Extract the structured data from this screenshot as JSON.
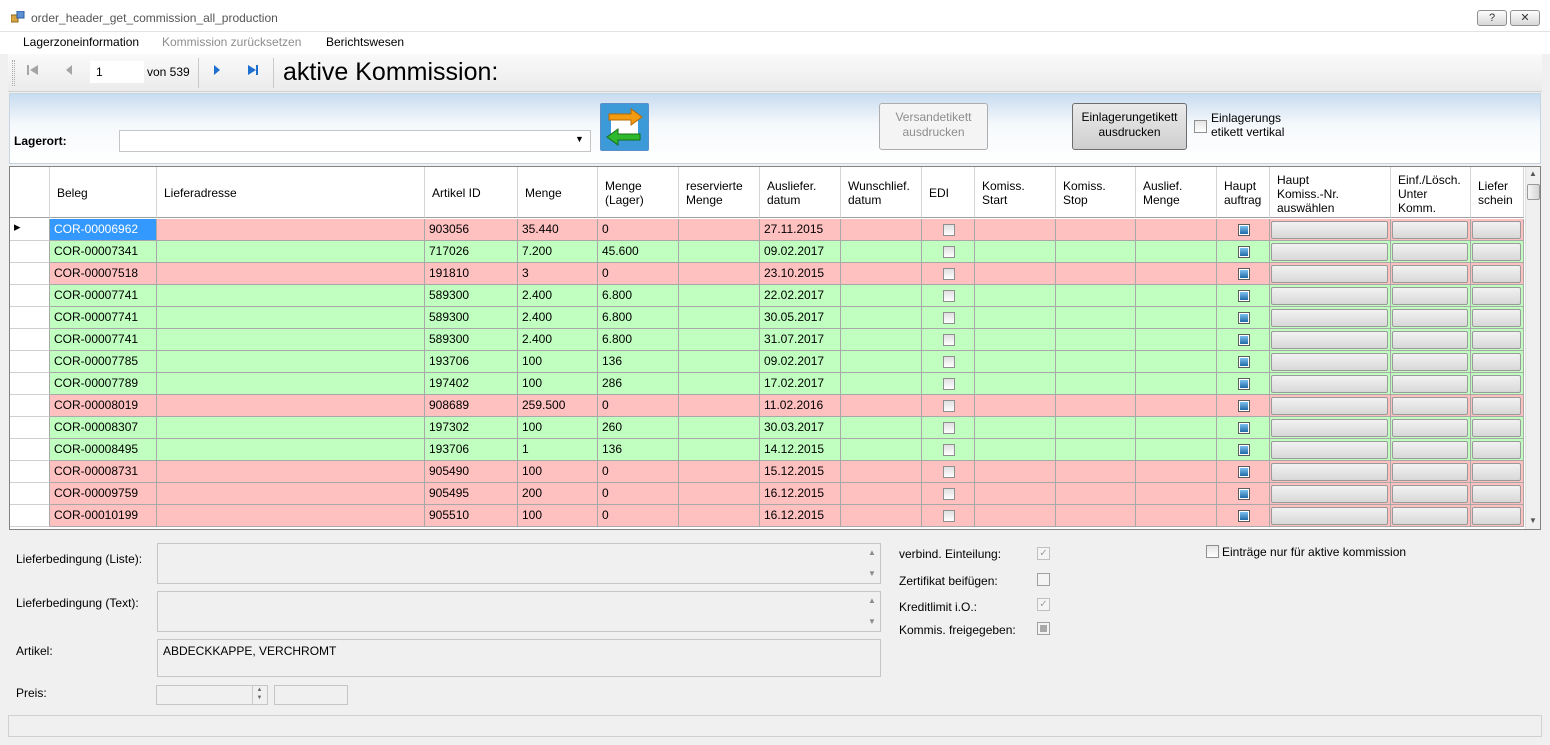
{
  "window": {
    "title": "order_header_get_commission_all_production",
    "help_btn": "?",
    "close_btn": "✕"
  },
  "menu": [
    "Lagerzoneinformation",
    "Kommission zurücksetzen",
    "Berichtswesen"
  ],
  "nav": {
    "first": "⏮",
    "prev": "◀",
    "page": "1",
    "of": "von 539",
    "next": "▶",
    "last": "⏭",
    "active_label": "aktive Kommission:"
  },
  "panel": {
    "lagerort_label": "Lagerort:",
    "lagerort_value": "",
    "versand_btn": [
      "Versandetikett",
      "ausdrucken"
    ],
    "einlager_btn": [
      "Einlagerungetikett",
      "ausdrucken"
    ],
    "vertikal_label": [
      "Einlagerungs",
      "etikett vertikal"
    ],
    "vertikal_checked": false
  },
  "grid": {
    "columns": [
      {
        "key": "beleg",
        "label": [
          "Beleg"
        ]
      },
      {
        "key": "lieferadresse",
        "label": [
          "Lieferadresse"
        ]
      },
      {
        "key": "artikel",
        "label": [
          "Artikel ID"
        ]
      },
      {
        "key": "menge",
        "label": [
          "Menge"
        ]
      },
      {
        "key": "menge_lager",
        "label": [
          "Menge",
          "(Lager)"
        ]
      },
      {
        "key": "reserviert",
        "label": [
          "reservierte",
          "Menge"
        ]
      },
      {
        "key": "auslief",
        "label": [
          "Ausliefer.",
          "datum"
        ]
      },
      {
        "key": "wunsch",
        "label": [
          "Wunschlief.",
          "datum"
        ]
      },
      {
        "key": "edi",
        "label": [
          "EDI"
        ]
      },
      {
        "key": "kstart",
        "label": [
          "Komiss.",
          "Start"
        ]
      },
      {
        "key": "kstop",
        "label": [
          "Komiss.",
          "Stop"
        ]
      },
      {
        "key": "amenge",
        "label": [
          "Auslief.",
          "Menge"
        ]
      },
      {
        "key": "haupt",
        "label": [
          "Haupt",
          "auftrag"
        ]
      },
      {
        "key": "hauptk",
        "label": [
          "Haupt",
          "Komiss.-Nr.",
          "auswählen"
        ]
      },
      {
        "key": "einf",
        "label": [
          "Einf./Lösch.",
          "Unter",
          "Komm."
        ]
      },
      {
        "key": "liefer",
        "label": [
          "Liefer",
          "schein"
        ]
      }
    ],
    "rows": [
      {
        "beleg": "COR-00006962",
        "artikel": "903056",
        "menge": "35.440",
        "menge_lager": "0",
        "auslief": "27.11.2015",
        "status": "red",
        "selected": true,
        "current": true
      },
      {
        "beleg": "COR-00007341",
        "artikel": "717026",
        "menge": "7.200",
        "menge_lager": "45.600",
        "auslief": "09.02.2017",
        "status": "green"
      },
      {
        "beleg": "COR-00007518",
        "artikel": "191810",
        "menge": "3",
        "menge_lager": "0",
        "auslief": "23.10.2015",
        "status": "red"
      },
      {
        "beleg": "COR-00007741",
        "artikel": "589300",
        "menge": "2.400",
        "menge_lager": "6.800",
        "auslief": "22.02.2017",
        "status": "green"
      },
      {
        "beleg": "COR-00007741",
        "artikel": "589300",
        "menge": "2.400",
        "menge_lager": "6.800",
        "auslief": "30.05.2017",
        "status": "green"
      },
      {
        "beleg": "COR-00007741",
        "artikel": "589300",
        "menge": "2.400",
        "menge_lager": "6.800",
        "auslief": "31.07.2017",
        "status": "green"
      },
      {
        "beleg": "COR-00007785",
        "artikel": "193706",
        "menge": "100",
        "menge_lager": "136",
        "auslief": "09.02.2017",
        "status": "green"
      },
      {
        "beleg": "COR-00007789",
        "artikel": "197402",
        "menge": "100",
        "menge_lager": "286",
        "auslief": "17.02.2017",
        "status": "green"
      },
      {
        "beleg": "COR-00008019",
        "artikel": "908689",
        "menge": "259.500",
        "menge_lager": "0",
        "auslief": "11.02.2016",
        "status": "red"
      },
      {
        "beleg": "COR-00008307",
        "artikel": "197302",
        "menge": "100",
        "menge_lager": "260",
        "auslief": "30.03.2017",
        "status": "green"
      },
      {
        "beleg": "COR-00008495",
        "artikel": "193706",
        "menge": "1",
        "menge_lager": "136",
        "auslief": "14.12.2015",
        "status": "green"
      },
      {
        "beleg": "COR-00008731",
        "artikel": "905490",
        "menge": "100",
        "menge_lager": "0",
        "auslief": "15.12.2015",
        "status": "red"
      },
      {
        "beleg": "COR-00009759",
        "artikel": "905495",
        "menge": "200",
        "menge_lager": "0",
        "auslief": "16.12.2015",
        "status": "red"
      },
      {
        "beleg": "COR-00010199",
        "artikel": "905510",
        "menge": "100",
        "menge_lager": "0",
        "auslief": "16.12.2015",
        "status": "red"
      }
    ]
  },
  "details": {
    "lieferbed_liste_label": "Lieferbedingung (Liste):",
    "lieferbed_text_label": "Lieferbedingung (Text):",
    "artikel_label": "Artikel:",
    "artikel_value": "ABDECKKAPPE, VERCHROMT",
    "preis_label": "Preis:",
    "verbind_label": "verbind. Einteilung:",
    "zertifikat_label": "Zertifikat beifügen:",
    "kreditlimit_label": "Kreditlimit i.O.:",
    "freigegeben_label": "Kommis. freigegeben:",
    "nur_aktive_label": "Einträge nur für aktive kommission"
  },
  "colors": {
    "red_row": "#ffc0c0",
    "green_row": "#c0ffc0",
    "selected": "#3399ff"
  }
}
